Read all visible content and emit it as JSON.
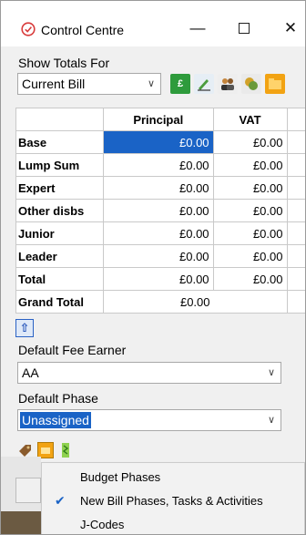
{
  "window": {
    "title": "Control Centre",
    "minimize_glyph": "—",
    "close_glyph": "✕"
  },
  "show_totals": {
    "label": "Show Totals For",
    "selected": "Current Bill"
  },
  "toolbar": {
    "icons": [
      "calculator-icon",
      "edit-icon",
      "people-icon",
      "coins-icon",
      "folder-icon"
    ],
    "calc_glyph": "£"
  },
  "totals_table": {
    "columns": [
      "",
      "Principal",
      "VAT"
    ],
    "rows": [
      {
        "label": "Base",
        "principal": "£0.00",
        "vat": "£0.00"
      },
      {
        "label": "Lump Sum",
        "principal": "£0.00",
        "vat": "£0.00"
      },
      {
        "label": "Expert",
        "principal": "£0.00",
        "vat": "£0.00"
      },
      {
        "label": "Other disbs",
        "principal": "£0.00",
        "vat": "£0.00"
      },
      {
        "label": "Junior",
        "principal": "£0.00",
        "vat": "£0.00"
      },
      {
        "label": "Leader",
        "principal": "£0.00",
        "vat": "£0.00"
      },
      {
        "label": "Total",
        "principal": "£0.00",
        "vat": "£0.00"
      }
    ],
    "grand_total": {
      "label": "Grand Total",
      "value": "£0.00"
    }
  },
  "collapse_button": {
    "icon": "up-arrow-icon",
    "glyph": "⇧"
  },
  "default_fee_earner": {
    "label": "Default Fee Earner",
    "selected": "AA"
  },
  "default_phase": {
    "label": "Default Phase",
    "selected": "Unassigned"
  },
  "phase_menu": {
    "items": [
      {
        "label": "Budget Phases",
        "checked": false
      },
      {
        "label": "New Bill Phases, Tasks & Activities",
        "checked": true
      },
      {
        "label": "J-Codes",
        "checked": false
      }
    ],
    "check_glyph": "✔"
  },
  "colors": {
    "selection": "#1a63c6",
    "green_icon": "#2e9b3c",
    "orange_icon": "#f2a313"
  }
}
